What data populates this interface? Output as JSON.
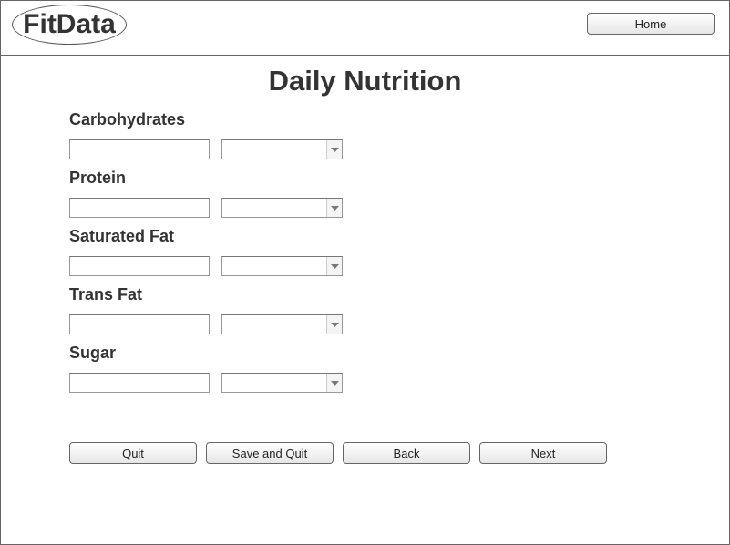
{
  "app": {
    "logo_text": "FitData"
  },
  "header": {
    "home_label": "Home"
  },
  "page": {
    "title": "Daily Nutrition"
  },
  "fields": [
    {
      "label": "Carbohydrates",
      "value": "",
      "unit": ""
    },
    {
      "label": "Protein",
      "value": "",
      "unit": ""
    },
    {
      "label": "Saturated Fat",
      "value": "",
      "unit": ""
    },
    {
      "label": "Trans Fat",
      "value": "",
      "unit": ""
    },
    {
      "label": "Sugar",
      "value": "",
      "unit": ""
    }
  ],
  "buttons": {
    "quit": "Quit",
    "save_quit": "Save and Quit",
    "back": "Back",
    "next": "Next"
  },
  "icons": {
    "select_arrow": "triangle-down-icon"
  },
  "colors": {
    "border": "#666666",
    "text": "#333333",
    "background": "#ffffff"
  }
}
